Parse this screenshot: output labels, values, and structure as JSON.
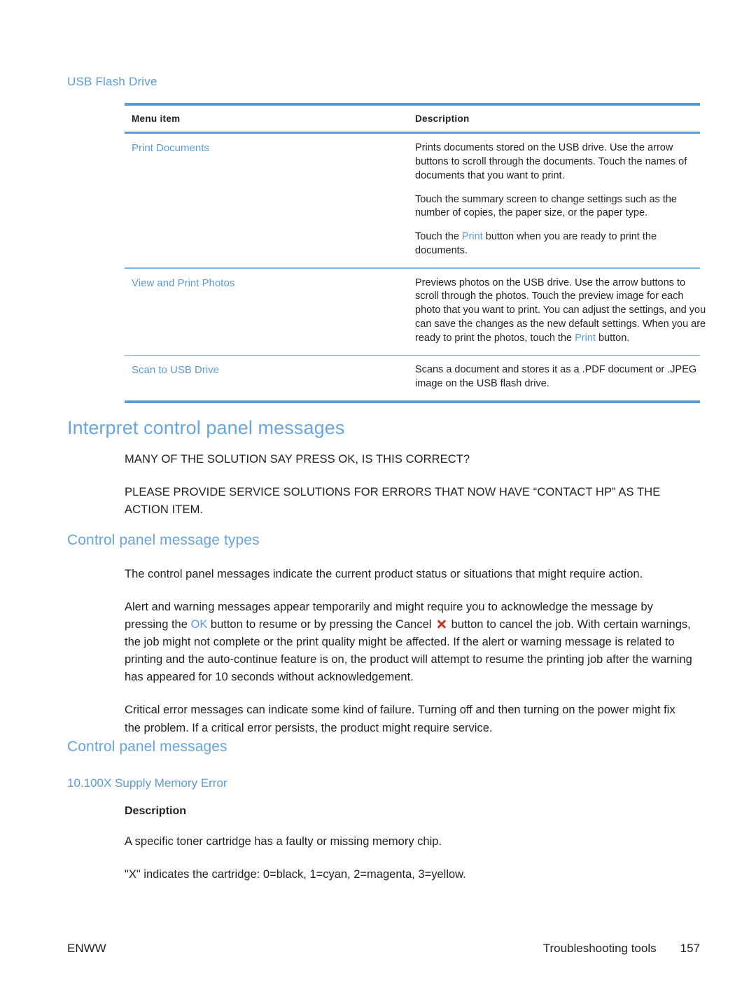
{
  "section": {
    "subheading": "USB Flash Drive"
  },
  "table": {
    "headers": [
      "Menu item",
      "Description"
    ],
    "rows": [
      {
        "menu_item": "Print Documents",
        "paragraphs": [
          {
            "parts": [
              {
                "text": "Prints documents stored on the USB drive. Use the arrow buttons to scroll through the documents. Touch the names of documents that you want to print.",
                "style": "normal"
              }
            ]
          },
          {
            "parts": [
              {
                "text": "Touch the summary screen to change settings such as the number of copies, the paper size, or the paper type.",
                "style": "normal"
              }
            ]
          },
          {
            "parts": [
              {
                "text": "Touch the ",
                "style": "normal"
              },
              {
                "text": "Print",
                "style": "link"
              },
              {
                "text": " button when you are ready to print the documents.",
                "style": "normal"
              }
            ]
          }
        ]
      },
      {
        "menu_item": "View and Print Photos",
        "paragraphs": [
          {
            "parts": [
              {
                "text": "Previews photos on the USB drive. Use the arrow buttons to scroll through the photos. Touch the preview image for each photo that you want to print. You can adjust the settings, and you can save the changes as the new default settings. When you are ready to print the photos, touch the ",
                "style": "normal"
              },
              {
                "text": "Print",
                "style": "link"
              },
              {
                "text": " button.",
                "style": "normal"
              }
            ]
          }
        ]
      },
      {
        "menu_item": "Scan to USB Drive",
        "paragraphs": [
          {
            "parts": [
              {
                "text": "Scans a document and stores it as a .PDF document or .JPEG image on the USB flash drive.",
                "style": "normal"
              }
            ]
          }
        ]
      }
    ]
  },
  "headings": {
    "h1_interpret": "Interpret control panel messages",
    "h2_message_types": "Control panel message types",
    "h2_control_panel_messages": "Control panel messages",
    "h3_error_code": "10.100X Supply Memory Error",
    "h4_description": "Description"
  },
  "intro_notes": {
    "note_1": "MANY OF THE SOLUTION SAY PRESS OK, IS THIS CORRECT?",
    "note_2": "PLEASE PROVIDE SERVICE SOLUTIONS FOR ERRORS THAT NOW HAVE “CONTACT HP” AS THE ACTION ITEM."
  },
  "message_types": {
    "para_1": "The control panel messages indicate the current product status or situations that might require action.",
    "para_2_a": "Alert and warning messages appear temporarily and might require you to acknowledge the message by pressing the ",
    "para_2_ok": "OK",
    "para_2_b": " button to resume or by pressing the Cancel ",
    "para_2_c": " button to cancel the job. With certain warnings, the job might not complete or the print quality might be affected. If the alert or warning message is related to printing and the auto-continue feature is on, the product will attempt to resume the printing job after the warning has appeared for 10 seconds without acknowledgement.",
    "para_3": "Critical error messages can indicate some kind of failure. Turning off and then turning on the power might fix the problem. If a critical error persists, the product might require service."
  },
  "description_block": {
    "para_1": "A specific toner cartridge has a faulty or missing memory chip.",
    "para_2": "\"X\" indicates the cartridge: 0=black, 1=cyan, 2=magenta, 3=yellow."
  },
  "footer": {
    "left": "ENWW",
    "chapter": "Troubleshooting tools",
    "page": "157"
  },
  "colors": {
    "accent_blue": "#5b9bd5",
    "heading_blue": "#67a5de",
    "cancel_red": "#c0392b",
    "text": "#231f20"
  }
}
